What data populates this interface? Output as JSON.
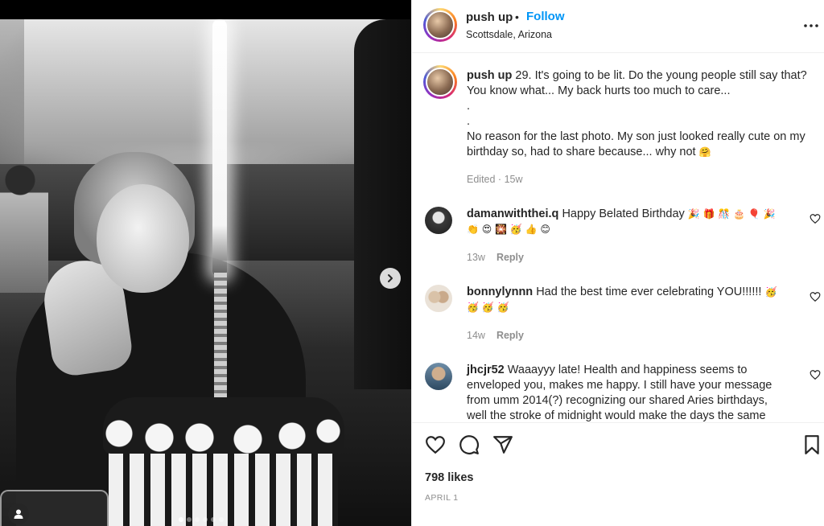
{
  "post": {
    "username": "push up",
    "follow_label": "Follow",
    "separator": "•",
    "location": "Scottsdale, Arizona",
    "more_icon": "more-horizontal-icon"
  },
  "caption": {
    "username": "push up",
    "line1": "29. It's going to be lit. Do the young people still say that? You know what... My back hurts too much to care...",
    "line2": ".",
    "line3": ".",
    "line4": "No reason for the last photo. My son just looked really cute on my birthday so, had to share because... why not",
    "emoji": "🤗",
    "edited": "Edited",
    "age": "15w"
  },
  "comments": [
    {
      "username": "damanwiththei.q",
      "text": "Happy Belated Birthday",
      "emojis": "🎉 🎁 🎊 🎂 🎈 🎉 👏 😍 🎇 🥳 👍 😊",
      "age": "13w",
      "reply_label": "Reply"
    },
    {
      "username": "bonnylynnn",
      "text": "Had the best time ever celebrating YOU!!!!!!",
      "emojis": "🥳 🥳 🥳 🥳",
      "age": "14w",
      "reply_label": "Reply"
    },
    {
      "username": "jhcjr52",
      "text": "Waaayyy late! Health and happiness seems to enveloped you, makes me happy. I still have your message from umm 2014(?) recognizing our shared Aries birthdays, well the stroke of midnight would make the days the same"
    }
  ],
  "actions": {
    "like_icon": "heart-icon",
    "comment_icon": "comment-icon",
    "share_icon": "share-icon",
    "save_icon": "bookmark-icon",
    "likes": "798 likes",
    "date": "APRIL 1"
  },
  "carousel": {
    "slide_count": 6,
    "active_slide": 1
  }
}
